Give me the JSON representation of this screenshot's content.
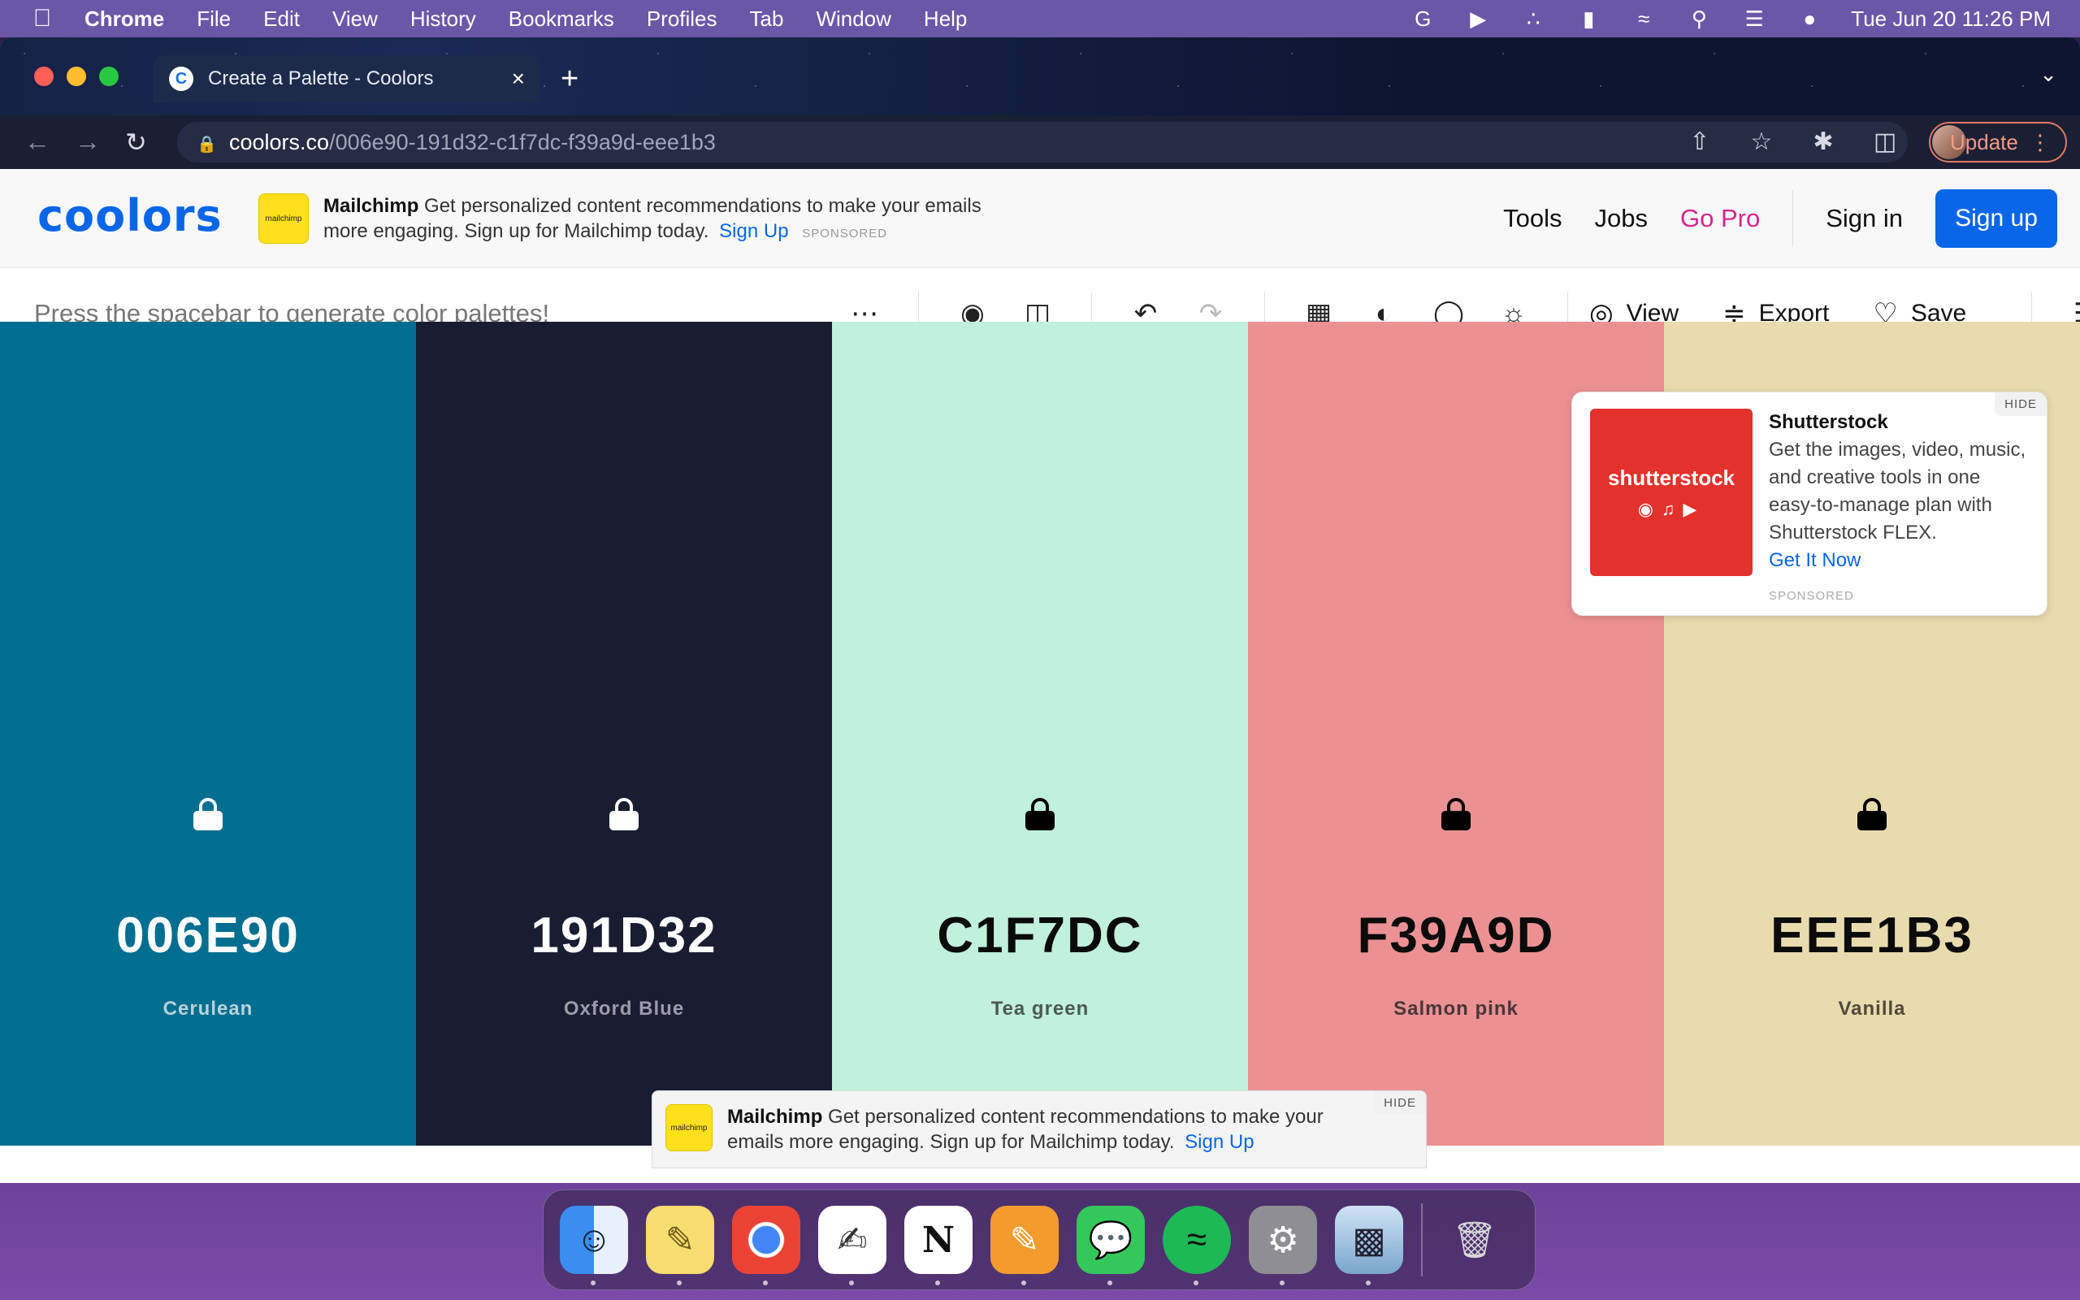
{
  "menubar": {
    "app": "Chrome",
    "items": [
      "File",
      "Edit",
      "View",
      "History",
      "Bookmarks",
      "Profiles",
      "Tab",
      "Window",
      "Help"
    ],
    "datetime": "Tue Jun 20  11:26 PM"
  },
  "browser": {
    "tab_title": "Create a Palette - Coolors",
    "url_host": "coolors.co",
    "url_path": "/006e90-191d32-c1f7dc-f39a9d-eee1b3",
    "update_label": "Update"
  },
  "site": {
    "logo": "coolors",
    "top_ad": {
      "brand": "Mailchimp",
      "text": "Get personalized content recommendations to make your emails more engaging. Sign up for Mailchimp today.",
      "cta": "Sign Up",
      "sponsored": "SPONSORED"
    },
    "nav": {
      "tools": "Tools",
      "jobs": "Jobs",
      "gopro": "Go Pro",
      "signin": "Sign in",
      "signup": "Sign up"
    }
  },
  "palette_toolbar": {
    "hint": "Press the spacebar to generate color palettes!",
    "view_label": "View",
    "export_label": "Export",
    "save_label": "Save"
  },
  "palette": [
    {
      "hex": "006E90",
      "name": "Cerulean",
      "bg": "#006e90",
      "fg": "#ffffff",
      "sub": "#b8d2da",
      "lock_color": "#ffffff"
    },
    {
      "hex": "191D32",
      "name": "Oxford Blue",
      "bg": "#191d32",
      "fg": "#ffffff",
      "sub": "#9a9cab",
      "lock_color": "#ffffff"
    },
    {
      "hex": "C1F7DC",
      "name": "Tea green",
      "bg": "#c1f0dc",
      "fg": "#0b0b0b",
      "sub": "#4a5a52",
      "lock_color": "#000000"
    },
    {
      "hex": "F39A9D",
      "name": "Salmon pink",
      "bg": "#eb9194",
      "fg": "#0b0b0b",
      "sub": "#4a3637",
      "lock_color": "#000000"
    },
    {
      "hex": "EEE1B3",
      "name": "Vanilla",
      "bg": "#e8dcae",
      "fg": "#0b0b0b",
      "sub": "#4f4a3a",
      "lock_color": "#000000"
    }
  ],
  "side_ad": {
    "brand": "Shutterstock",
    "image_text": "shutterstock",
    "text": "Get the images, video, music, and creative tools in one easy-to-manage plan with Shutterstock FLEX.",
    "cta": "Get It Now",
    "sponsored": "SPONSORED",
    "hide": "HIDE"
  },
  "bottom_ad": {
    "brand": "Mailchimp",
    "text": "Get personalized content recommendations to make your emails more engaging. Sign up for Mailchimp today.",
    "cta": "Sign Up",
    "hide": "HIDE"
  },
  "dock": [
    "finder-icon",
    "notes-icon",
    "chrome-icon",
    "textedit-icon",
    "notion-icon",
    "pages-icon",
    "messages-icon",
    "spotify-icon",
    "settings-icon",
    "preview-icon",
    "trash-icon"
  ]
}
